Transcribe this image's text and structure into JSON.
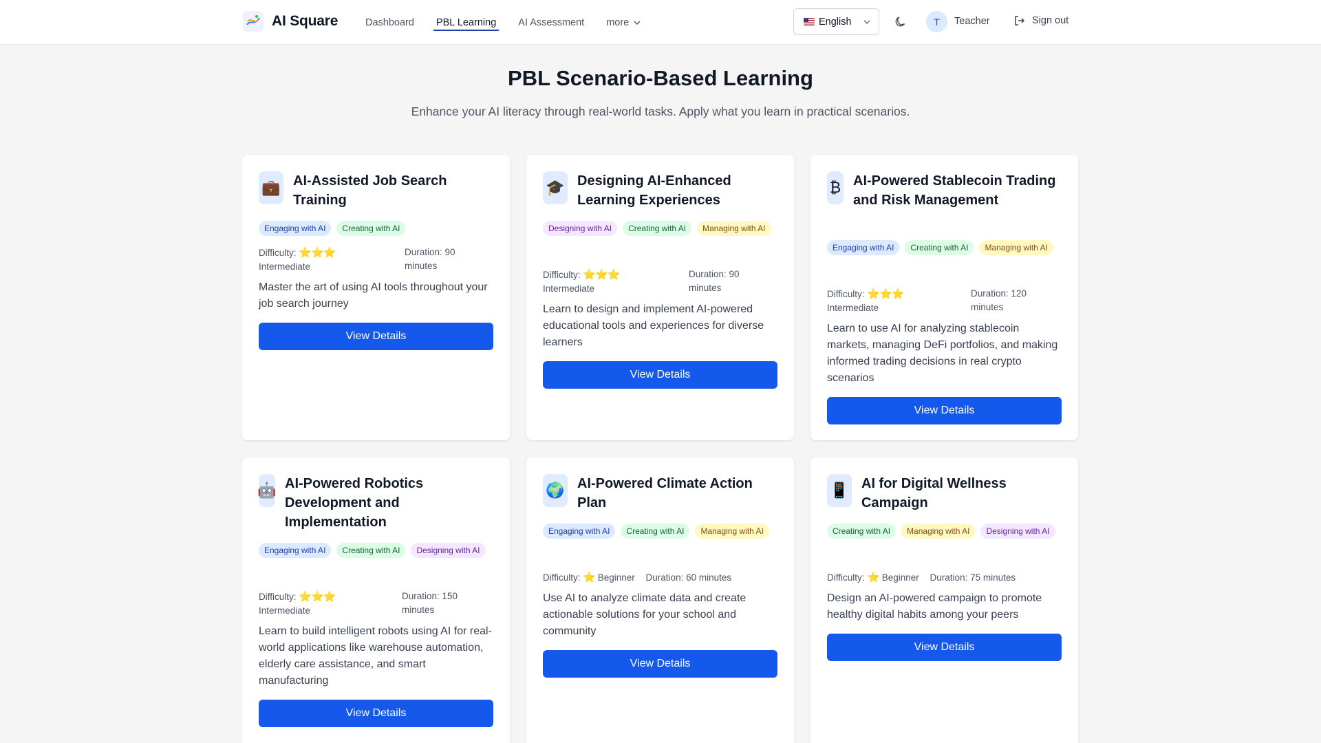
{
  "header": {
    "logo_text": "AI Square",
    "nav": [
      "Dashboard",
      "PBL Learning",
      "AI Assessment"
    ],
    "more_label": "more",
    "language": "English",
    "role": "Teacher",
    "avatar_initial": "T",
    "signout_label": "Sign out"
  },
  "hero": {
    "title": "PBL Scenario-Based Learning",
    "subtitle": "Enhance your AI literacy through real-world tasks. Apply what you learn in practical scenarios."
  },
  "labels": {
    "difficulty": "Difficulty:",
    "view_details": "View Details"
  },
  "scenarios": [
    {
      "icon": "💼",
      "title": "AI-Assisted Job Search Training",
      "tags": [
        "Engaging with AI",
        "Creating with AI"
      ],
      "stars": "⭐⭐⭐",
      "level": "Intermediate",
      "duration": "Duration: 90 minutes",
      "description": "Master the art of using AI tools throughout your job search journey"
    },
    {
      "icon": "🎓",
      "title": "Designing AI-Enhanced Learning Experiences",
      "tags": [
        "Designing with AI",
        "Creating with AI",
        "Managing with AI"
      ],
      "stars": "⭐⭐⭐",
      "level": "Intermediate",
      "duration": "Duration: 90 minutes",
      "description": "Learn to design and implement AI-powered educational tools and experiences for diverse learners"
    },
    {
      "icon": "₿",
      "title": "AI-Powered Stablecoin Trading and Risk Management",
      "tags": [
        "Engaging with AI",
        "Creating with AI",
        "Managing with AI"
      ],
      "stars": "⭐⭐⭐",
      "level": "Intermediate",
      "duration": "Duration: 120 minutes",
      "description": "Learn to use AI for analyzing stablecoin markets, managing DeFi portfolios, and making informed trading decisions in real crypto scenarios"
    },
    {
      "icon": "🤖",
      "title": "AI-Powered Robotics Development and Implementation",
      "tags": [
        "Engaging with AI",
        "Creating with AI",
        "Designing with AI"
      ],
      "stars": "⭐⭐⭐",
      "level": "Intermediate",
      "duration": "Duration: 150 minutes",
      "description": "Learn to build intelligent robots using AI for real-world applications like warehouse automation, elderly care assistance, and smart manufacturing"
    },
    {
      "icon": "🌍",
      "title": "AI-Powered Climate Action Plan",
      "tags": [
        "Engaging with AI",
        "Creating with AI",
        "Managing with AI"
      ],
      "stars": "⭐",
      "level": "Beginner",
      "duration": "Duration: 60 minutes",
      "description": "Use AI to analyze climate data and create actionable solutions for your school and community"
    },
    {
      "icon": "📱",
      "title": "AI for Digital Wellness Campaign",
      "tags": [
        "Creating with AI",
        "Managing with AI",
        "Designing with AI"
      ],
      "stars": "⭐",
      "level": "Beginner",
      "duration": "Duration: 75 minutes",
      "description": "Design an AI-powered campaign to promote healthy digital habits among your peers"
    }
  ]
}
